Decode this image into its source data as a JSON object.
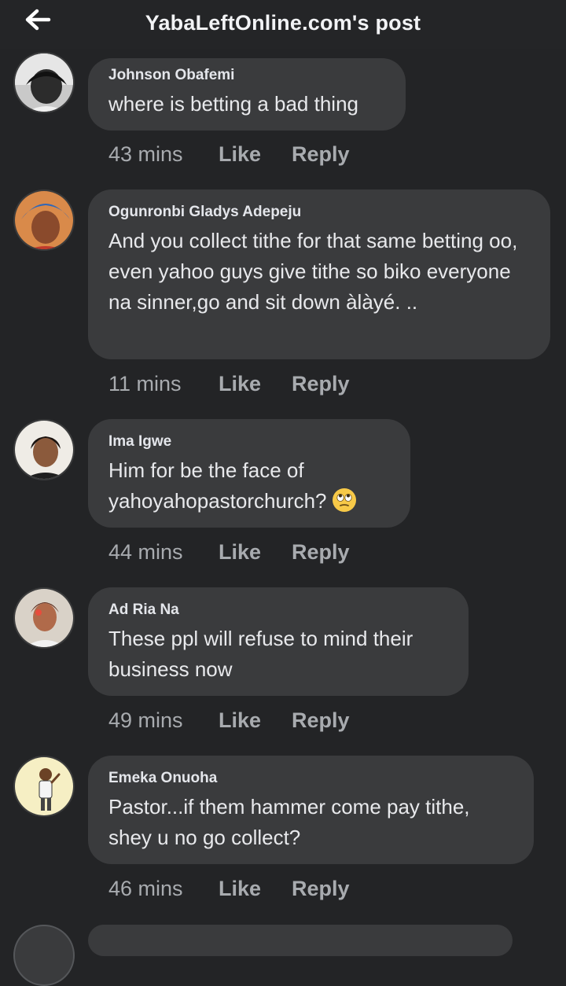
{
  "header": {
    "title": "YabaLeftOnline.com's post",
    "back_icon": "arrow-left-icon"
  },
  "colors": {
    "background": "#232426",
    "bubble": "#3a3b3d",
    "meta_text": "#a8abaf"
  },
  "comments": [
    {
      "author": "Johnson Obafemi",
      "text": "where is betting a bad thing",
      "time": "43 mins",
      "like": "Like",
      "reply": "Reply"
    },
    {
      "author": "Ogunronbi Gladys Adepeju",
      "text": "And you collect tithe for that same betting oo, even yahoo guys give tithe so biko everyone na sinner,go and sit down àlàyé. ..",
      "time": "11 mins",
      "like": "Like",
      "reply": "Reply"
    },
    {
      "author": "Ima Igwe",
      "text": "Him for be the face of yahoyahopastorchurch?",
      "emoji": "rolling-eyes-emoji",
      "time": "44 mins",
      "like": "Like",
      "reply": "Reply"
    },
    {
      "author": "Ad Ria Na",
      "text": "These ppl will refuse to mind their business now",
      "time": "49 mins",
      "like": "Like",
      "reply": "Reply"
    },
    {
      "author": "Emeka Onuoha",
      "text": "Pastor...if them hammer come pay tithe, shey u no go collect?",
      "time": "46 mins",
      "like": "Like",
      "reply": "Reply"
    }
  ]
}
